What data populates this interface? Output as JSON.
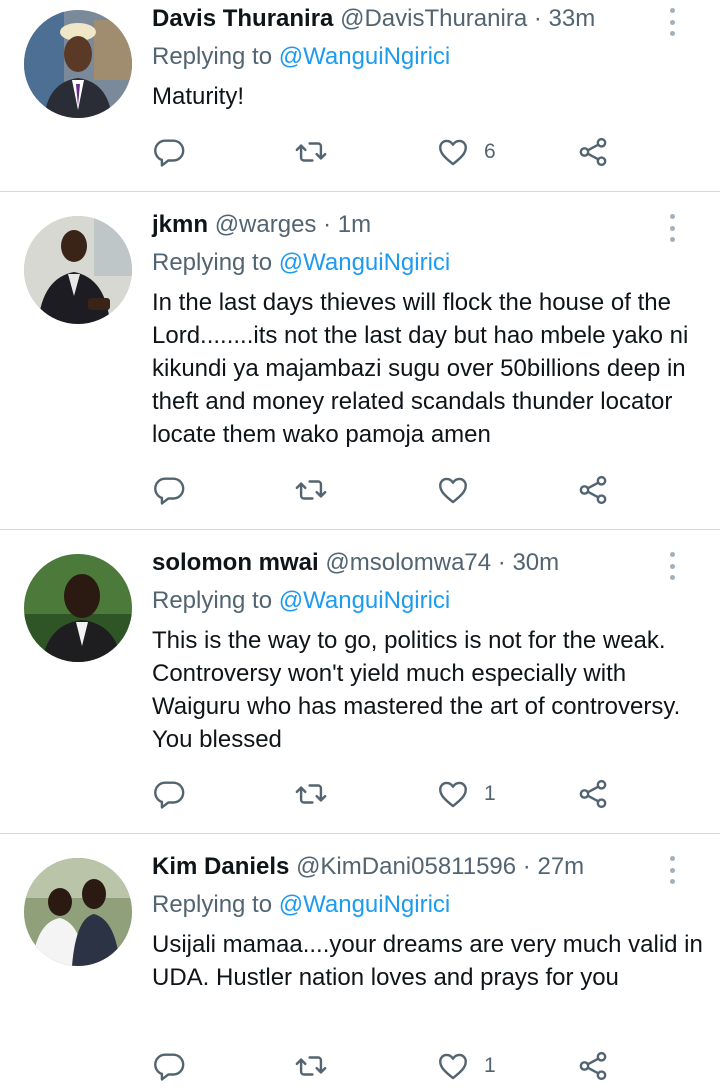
{
  "tweets": [
    {
      "name": "Davis Thuranira",
      "handle": "@DavisThuranira",
      "sep": "·",
      "time": "33m",
      "replying_label": "Replying to ",
      "replying_to": "@WanguiNgirici",
      "text": "Maturity!",
      "likes": "6"
    },
    {
      "name": "jkmn",
      "handle": "@warges",
      "sep": "·",
      "time": "1m",
      "replying_label": "Replying to ",
      "replying_to": "@WanguiNgirici",
      "text": "In the last days thieves will flock the house of the Lord........its not the last day but hao mbele yako ni kikundi ya majambazi sugu over 50billions deep in theft and money related scandals thunder locator locate them wako pamoja amen",
      "likes": ""
    },
    {
      "name": "solomon mwai",
      "handle": "@msolomwa74",
      "sep": "·",
      "time": "30m",
      "replying_label": "Replying to ",
      "replying_to": "@WanguiNgirici",
      "text": "This is the way to go, politics is not for the weak. Controversy won't yield much especially with Waiguru who has mastered the art of controversy. You blessed",
      "likes": "1"
    },
    {
      "name": "Kim Daniels",
      "handle": "@KimDani05811596",
      "sep": "·",
      "time": "27m",
      "replying_label": "Replying to ",
      "replying_to": "@WanguiNgirici",
      "text": "Usijali mamaa....your dreams are very much valid in UDA.  Hustler nation loves and prays for you",
      "likes": "1"
    }
  ],
  "icons": {
    "reply": "reply-icon",
    "retweet": "retweet-icon",
    "like": "heart-icon",
    "share": "share-icon",
    "more": "more-vertical-icon"
  },
  "colors": {
    "link": "#1d9bf0",
    "secondary_text": "#536471",
    "divider": "#cfd9de"
  }
}
